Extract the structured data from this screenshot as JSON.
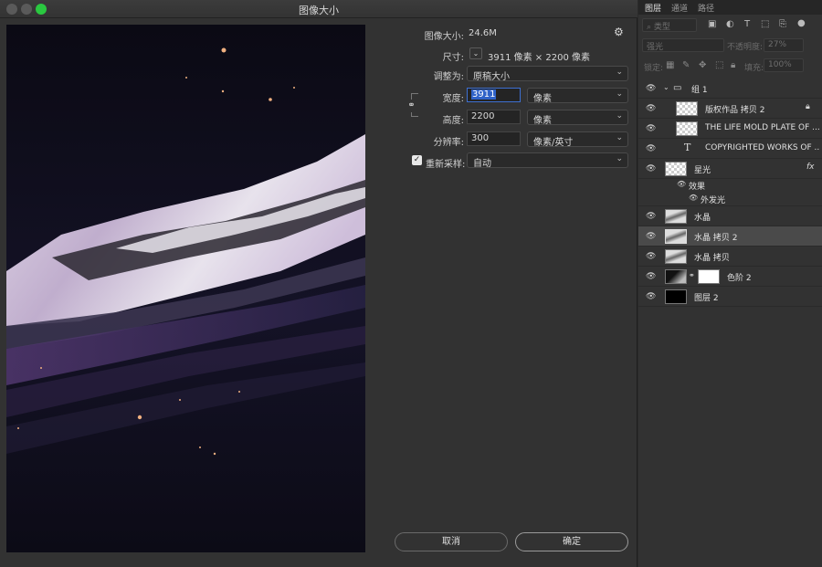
{
  "dialog": {
    "title": "图像大小",
    "image_size_label": "图像大小:",
    "image_size_value": "24.6M",
    "dimensions_label": "尺寸:",
    "dimensions_value": "3911 像素 × 2200 像素",
    "fit_to_label": "调整为:",
    "fit_to_value": "原稿大小",
    "width_label": "宽度:",
    "width_value": "3911",
    "width_unit": "像素",
    "height_label": "高度:",
    "height_value": "2200",
    "height_unit": "像素",
    "resolution_label": "分辨率:",
    "resolution_value": "300",
    "resolution_unit": "像素/英寸",
    "resample_label": "重新采样:",
    "resample_checked": true,
    "resample_value": "自动",
    "cancel_label": "取消",
    "ok_label": "确定",
    "gear_icon": "gear-icon"
  },
  "panel": {
    "tabs": [
      "图层",
      "通道",
      "路径"
    ],
    "filter_kind": "类型",
    "blend_mode": "强光",
    "opacity_label": "不透明度:",
    "opacity_value": "27%",
    "lock_label": "锁定:",
    "fill_label": "填充:",
    "fill_value": "100%",
    "layers": [
      {
        "name": "组 1",
        "type": "group"
      },
      {
        "name": "版权作品 拷贝 2",
        "type": "image",
        "locked": true
      },
      {
        "name": "THE LIFE MOLD PLATE OF ...",
        "type": "image"
      },
      {
        "name": "COPYRIGHTED WORKS OF ...",
        "type": "text"
      },
      {
        "name": "星光",
        "type": "image",
        "fx": "fx"
      },
      {
        "name": "效果",
        "type": "effects"
      },
      {
        "name": "外发光",
        "type": "effect"
      },
      {
        "name": "水晶",
        "type": "image"
      },
      {
        "name": "水晶 拷贝 2",
        "type": "image",
        "selected": true
      },
      {
        "name": "水晶 拷贝",
        "type": "image"
      },
      {
        "name": "色阶 2",
        "type": "adjustment"
      },
      {
        "name": "图层 2",
        "type": "image"
      }
    ]
  },
  "colors": {
    "accent": "#2f62c8",
    "background": "#323232"
  }
}
